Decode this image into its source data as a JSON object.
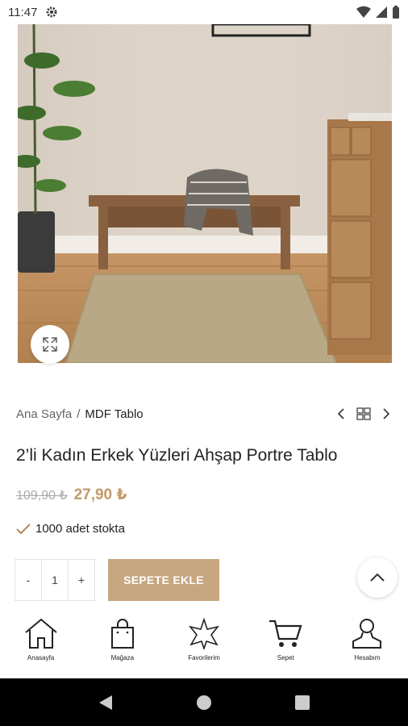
{
  "status_bar": {
    "time": "11:47"
  },
  "breadcrumb": {
    "home": "Ana Sayfa",
    "separator": "/",
    "current": "MDF Tablo"
  },
  "product": {
    "title": "2’li Kadın Erkek Yüzleri Ahşap Portre Tablo",
    "old_price": "109,90 ₺",
    "new_price": "27,90 ₺",
    "stock_text": "1000 adet stokta"
  },
  "quantity": {
    "minus": "-",
    "value": "1",
    "plus": "+"
  },
  "add_to_cart_label": "SEPETE EKLE",
  "bottom_nav": [
    {
      "label": "Anasayfa",
      "icon": "home-icon"
    },
    {
      "label": "Mağaza",
      "icon": "shopping-bag-icon"
    },
    {
      "label": "Favorilerim",
      "icon": "star-icon"
    },
    {
      "label": "Sepet",
      "icon": "cart-icon"
    },
    {
      "label": "Hesabım",
      "icon": "user-icon"
    }
  ],
  "colors": {
    "accent": "#c7a77f",
    "price": "#c29a6a"
  }
}
